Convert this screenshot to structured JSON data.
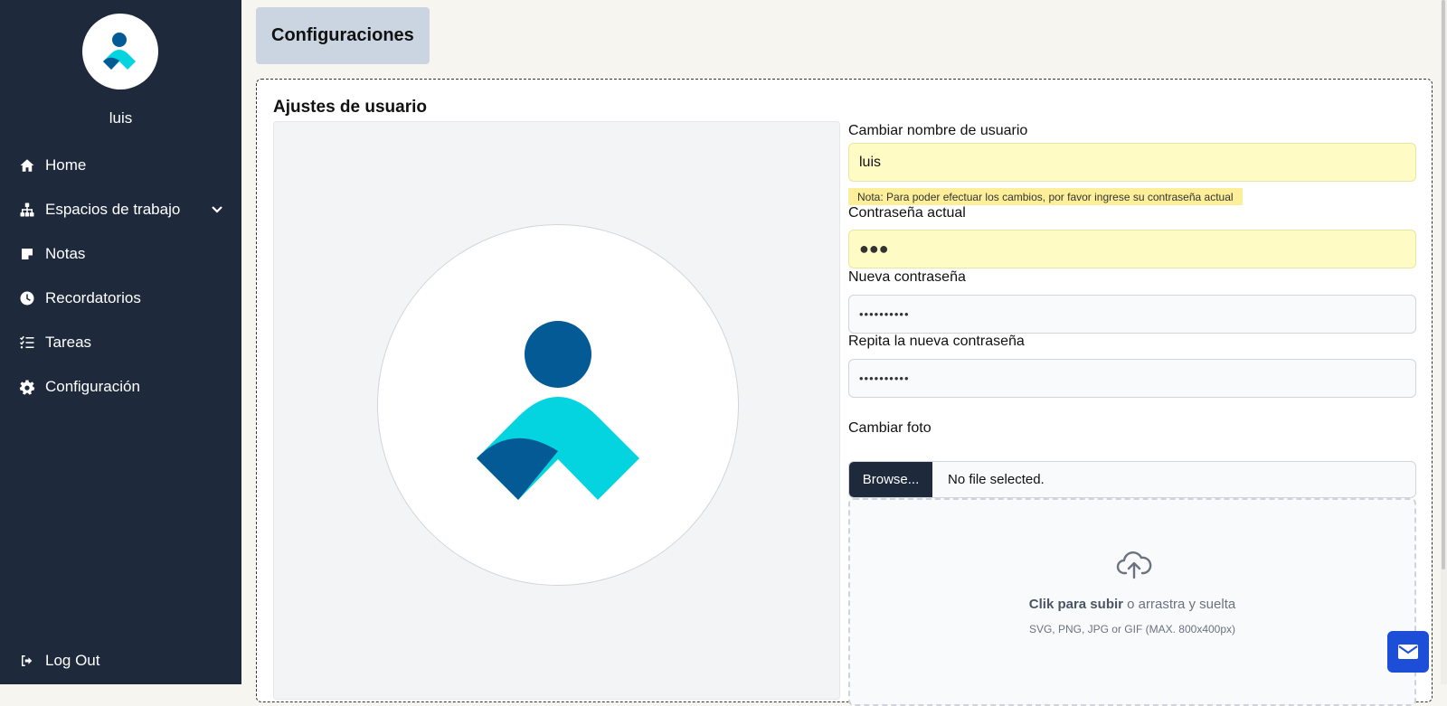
{
  "sidebar": {
    "username": "luis",
    "avatar_icon": "user-logo-icon",
    "items": [
      {
        "label": "Home",
        "icon": "home-icon"
      },
      {
        "label": "Espacios de trabajo",
        "icon": "sitemap-icon",
        "expand_icon": "chevron-down-icon"
      },
      {
        "label": "Notas",
        "icon": "note-icon"
      },
      {
        "label": "Recordatorios",
        "icon": "clock-icon"
      },
      {
        "label": "Tareas",
        "icon": "task-list-icon"
      },
      {
        "label": "Configuración",
        "icon": "gear-icon"
      }
    ],
    "logout": {
      "label": "Log Out",
      "icon": "logout-icon"
    }
  },
  "header": {
    "title": "Configuraciones"
  },
  "panel": {
    "title": "Ajustes de usuario",
    "username_field": {
      "label": "Cambiar nombre de usuario",
      "value": "luis"
    },
    "note": "Nota: Para poder efectuar los cambios, por favor ingrese su contraseña actual",
    "current_password": {
      "label": "Contraseña actual",
      "value": "●●●"
    },
    "new_password": {
      "label": "Nueva contraseña",
      "value": "••••••••••"
    },
    "repeat_password": {
      "label": "Repita la nueva contraseña",
      "value": "••••••••••"
    },
    "photo": {
      "label": "Cambiar foto",
      "browse_label": "Browse...",
      "file_status": "No file selected.",
      "dropzone_bold": "Clik para subir",
      "dropzone_rest": "o arrastra y suelta",
      "dropzone_hint": "SVG, PNG, JPG or GIF (MAX. 800x400px)",
      "dropzone_icon": "cloud-upload-icon"
    }
  },
  "floating": {
    "icon": "mail-icon"
  },
  "colors": {
    "sidebar_bg": "#1e293b",
    "page_bg": "#f7f5ef",
    "logo_dark": "#045a94",
    "logo_light": "#03d4e0",
    "accent_button": "#1d4ed8",
    "highlight_input": "#fefbc5"
  }
}
